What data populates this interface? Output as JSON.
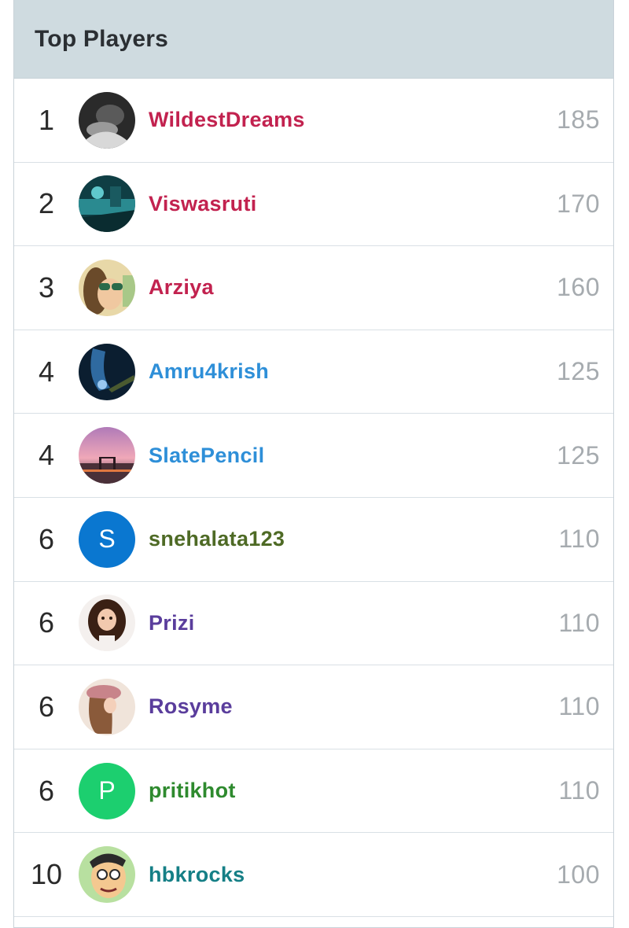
{
  "panel": {
    "title": "Top Players"
  },
  "colors": {
    "red": "#c2224f",
    "blue": "#2e8fd8",
    "olive": "#4e6a25",
    "purple": "#5a3d9c",
    "green": "#2e8a2e",
    "teal": "#157f86",
    "score_gray": "#a6abaf",
    "header_bg": "#cfdbe0"
  },
  "players": [
    {
      "rank": "1",
      "name": "WildestDreams",
      "score": "185",
      "name_color": "#c2224f",
      "avatar": "photo-dark"
    },
    {
      "rank": "2",
      "name": "Viswasruti",
      "score": "170",
      "name_color": "#c2224f",
      "avatar": "photo-teal"
    },
    {
      "rank": "3",
      "name": "Arziya",
      "score": "160",
      "name_color": "#c2224f",
      "avatar": "photo-sunglasses"
    },
    {
      "rank": "4",
      "name": "Amru4krish",
      "score": "125",
      "name_color": "#2e8fd8",
      "avatar": "photo-night"
    },
    {
      "rank": "4",
      "name": "SlatePencil",
      "score": "125",
      "name_color": "#2e8fd8",
      "avatar": "photo-sunset"
    },
    {
      "rank": "6",
      "name": "snehalata123",
      "score": "110",
      "name_color": "#4e6a25",
      "avatar": "letter",
      "avatar_letter": "S",
      "avatar_color": "#0a77d0"
    },
    {
      "rank": "6",
      "name": "Prizi",
      "score": "110",
      "name_color": "#5a3d9c",
      "avatar": "photo-curly-hair"
    },
    {
      "rank": "6",
      "name": "Rosyme",
      "score": "110",
      "name_color": "#5a3d9c",
      "avatar": "photo-beret"
    },
    {
      "rank": "6",
      "name": "pritikhot",
      "score": "110",
      "name_color": "#2e8a2e",
      "avatar": "letter",
      "avatar_letter": "P",
      "avatar_color": "#1ccf6f"
    },
    {
      "rank": "10",
      "name": "hbkrocks",
      "score": "100",
      "name_color": "#157f86",
      "avatar": "photo-cartoon"
    }
  ]
}
